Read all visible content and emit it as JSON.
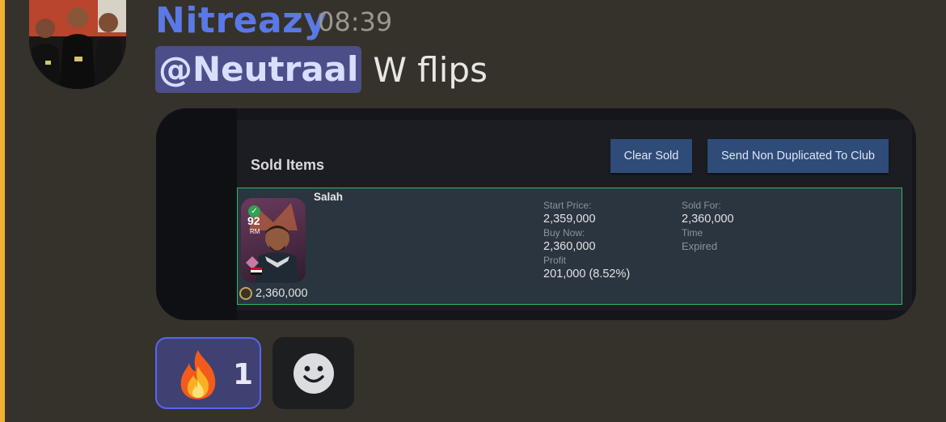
{
  "message": {
    "username": "Nitreazy",
    "timestamp": "08:39",
    "mention": "@Neutraal",
    "text": "W flips"
  },
  "embed": {
    "panel_title": "Sold Items",
    "buttons": {
      "clear": "Clear Sold",
      "send": "Send Non Duplicated To Club"
    },
    "item": {
      "player_name": "Salah",
      "rating": "92",
      "position": "RM",
      "price": "2,360,000",
      "start_price_label": "Start Price:",
      "start_price": "2,359,000",
      "buy_now_label": "Buy Now:",
      "buy_now": "2,360,000",
      "profit_label": "Profit",
      "profit": "201,000 (8.52%)",
      "sold_for_label": "Sold For:",
      "sold_for": "2,360,000",
      "time_label": "Time",
      "time": "Expired"
    }
  },
  "reactions": {
    "fire_emoji": "fire-emoji",
    "fire_count": "1",
    "add_icon": "smiley-icon"
  },
  "colors": {
    "mention_bar": "#f0b132",
    "username": "#5a79e6",
    "mention_bg": "#4b4e89",
    "button_bg": "#2f4b78",
    "item_border": "#35b560",
    "reaction_border": "#5865f2"
  }
}
